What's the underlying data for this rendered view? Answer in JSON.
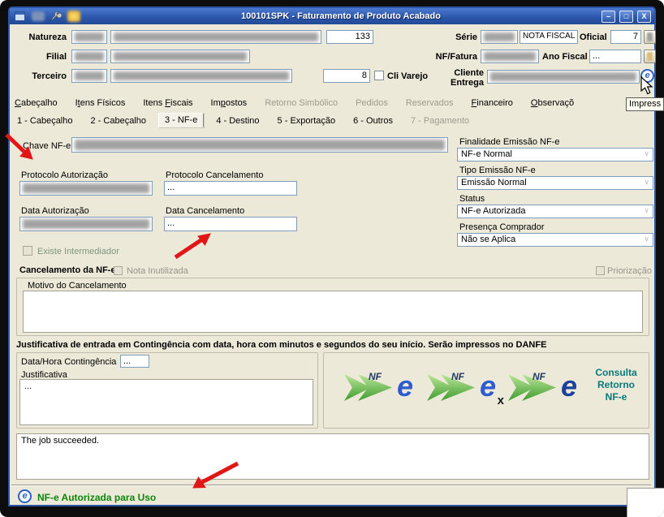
{
  "window": {
    "title": "100101SPK - Faturamento de Produto Acabado",
    "minimize": "–",
    "maximize": "□",
    "close": "X"
  },
  "header": {
    "natureza_label": "Natureza",
    "natureza_num": "133",
    "serie_label": "Série",
    "serie_desc": "NOTA FISCAL ELE",
    "oficial_label": "Oficial",
    "oficial_value": "7",
    "filial_label": "Filial",
    "nf_fatura_label": "NF/Fatura",
    "ano_fiscal_label": "Ano Fiscal",
    "ano_fiscal_value": "...",
    "terceiro_label": "Terceiro",
    "terceiro_num": "8",
    "cli_varejo_label": "Cli Varejo",
    "cliente_label": "Cliente",
    "entrega_label": "Entrega"
  },
  "tabs": [
    {
      "label": "Cabeçalho",
      "u": 0
    },
    {
      "label": "Itens Físicos",
      "u": 1
    },
    {
      "label": "Itens Fiscais",
      "u": 6
    },
    {
      "label": "Impostos",
      "u": 2
    },
    {
      "label": "Retorno Simbólico",
      "enabled": false
    },
    {
      "label": "Pedidos",
      "enabled": false
    },
    {
      "label": "Reservados",
      "enabled": false
    },
    {
      "label": "Financeiro",
      "u": 0
    },
    {
      "label": "Observaçõ",
      "u": 0
    }
  ],
  "subtabs": [
    {
      "label": "1 - Cabeçalho"
    },
    {
      "label": "2 - Cabeçalho"
    },
    {
      "label": "3 - NF-e",
      "active": true
    },
    {
      "label": "4 - Destino"
    },
    {
      "label": "5 - Exportação"
    },
    {
      "label": "6 - Outros"
    },
    {
      "label": "7 - Pagamento",
      "enabled": false
    }
  ],
  "tooltip": "Impress",
  "nfe": {
    "chave_label": "Chave NF-e",
    "protocolo_autorizacao_label": "Protocolo Autorização",
    "protocolo_cancelamento_label": "Protocolo Cancelamento",
    "protocolo_cancelamento_value": "...",
    "data_autorizacao_label": "Data Autorização",
    "data_cancelamento_label": "Data Cancelamento",
    "data_cancelamento_value": "...",
    "existe_intermediador_label": "Existe Intermediador",
    "finalidade_label": "Finalidade Emissão NF-e",
    "finalidade_value": "NF-e Normal",
    "tipo_emissao_label": "Tipo Emissão NF-e",
    "tipo_emissao_value": "Emissão Normal",
    "status_label": "Status",
    "status_value": "NF-e Autorizada",
    "presenca_label": "Presença Comprador",
    "presenca_value": "Não se Aplica"
  },
  "cancelamento": {
    "title": "Cancelamento da NF-e",
    "nota_inutilizada": "Nota Inutilizada",
    "priorizacao": "Priorização",
    "motivo_label": "Motivo do Cancelamento"
  },
  "contingencia": {
    "header": "Justificativa de entrada em Contingência com data, hora com minutos e segundos do seu início. Serão impressos no DANFE",
    "data_hora_label": "Data/Hora Contingência",
    "data_hora_value": "...",
    "justificativa_label": "Justificativa",
    "justificativa_value": "..."
  },
  "logos": {
    "nf": "NF",
    "e": "e",
    "cancel_suffix": "x"
  },
  "consulta": {
    "line1": "Consulta",
    "line2": "Retorno",
    "line3": "NF-e"
  },
  "log_text": "The job succeeded.",
  "status_text": "NF-e Autorizada para Uso"
}
